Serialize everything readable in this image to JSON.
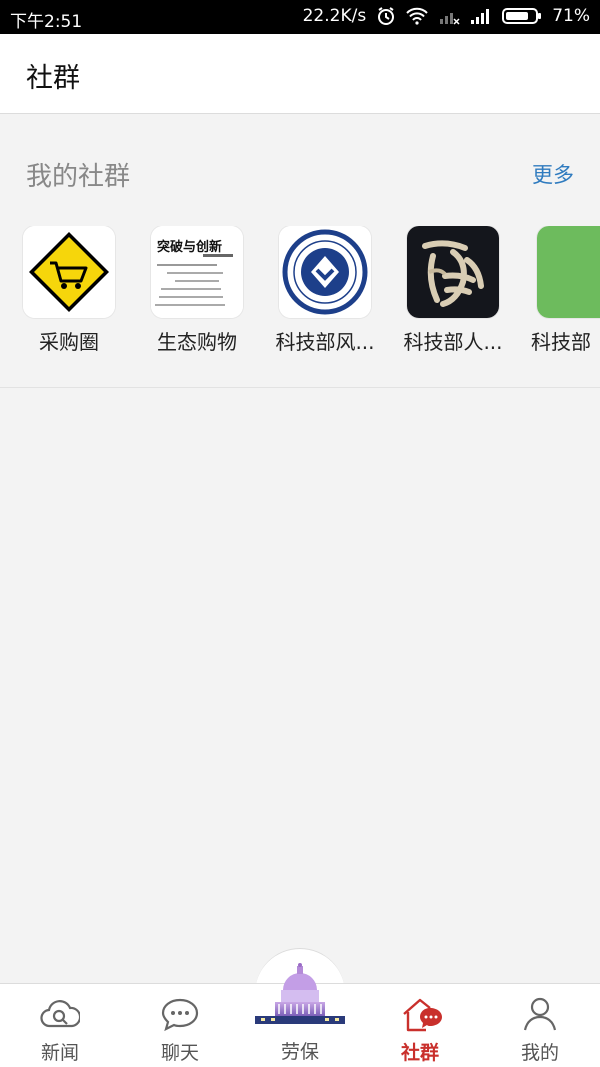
{
  "status_bar": {
    "time": "下午2:51",
    "network_speed": "22.2K/s",
    "battery": "71%"
  },
  "header": {
    "title": "社群"
  },
  "my_groups": {
    "title": "我的社群",
    "more_label": "更多",
    "items": [
      {
        "name": "采购圈",
        "icon": "cart-sign-icon"
      },
      {
        "name": "生态购物",
        "icon": "text-poster-icon",
        "poster_heading": "突破与创新"
      },
      {
        "name": "科技部风...",
        "icon": "blue-seal-icon"
      },
      {
        "name": "科技部人...",
        "icon": "calligraphy-icon"
      },
      {
        "name": "科技部",
        "icon": "green-square-icon"
      }
    ]
  },
  "tab_bar": {
    "tabs": [
      {
        "label": "新闻",
        "icon": "cloud-search-icon"
      },
      {
        "label": "聊天",
        "icon": "chat-bubble-icon"
      },
      {
        "label": "劳保",
        "icon": "capitol-building-icon"
      },
      {
        "label": "社群",
        "icon": "house-chat-icon",
        "active": true
      },
      {
        "label": "我的",
        "icon": "person-icon"
      }
    ],
    "active_color": "#c9302c"
  }
}
